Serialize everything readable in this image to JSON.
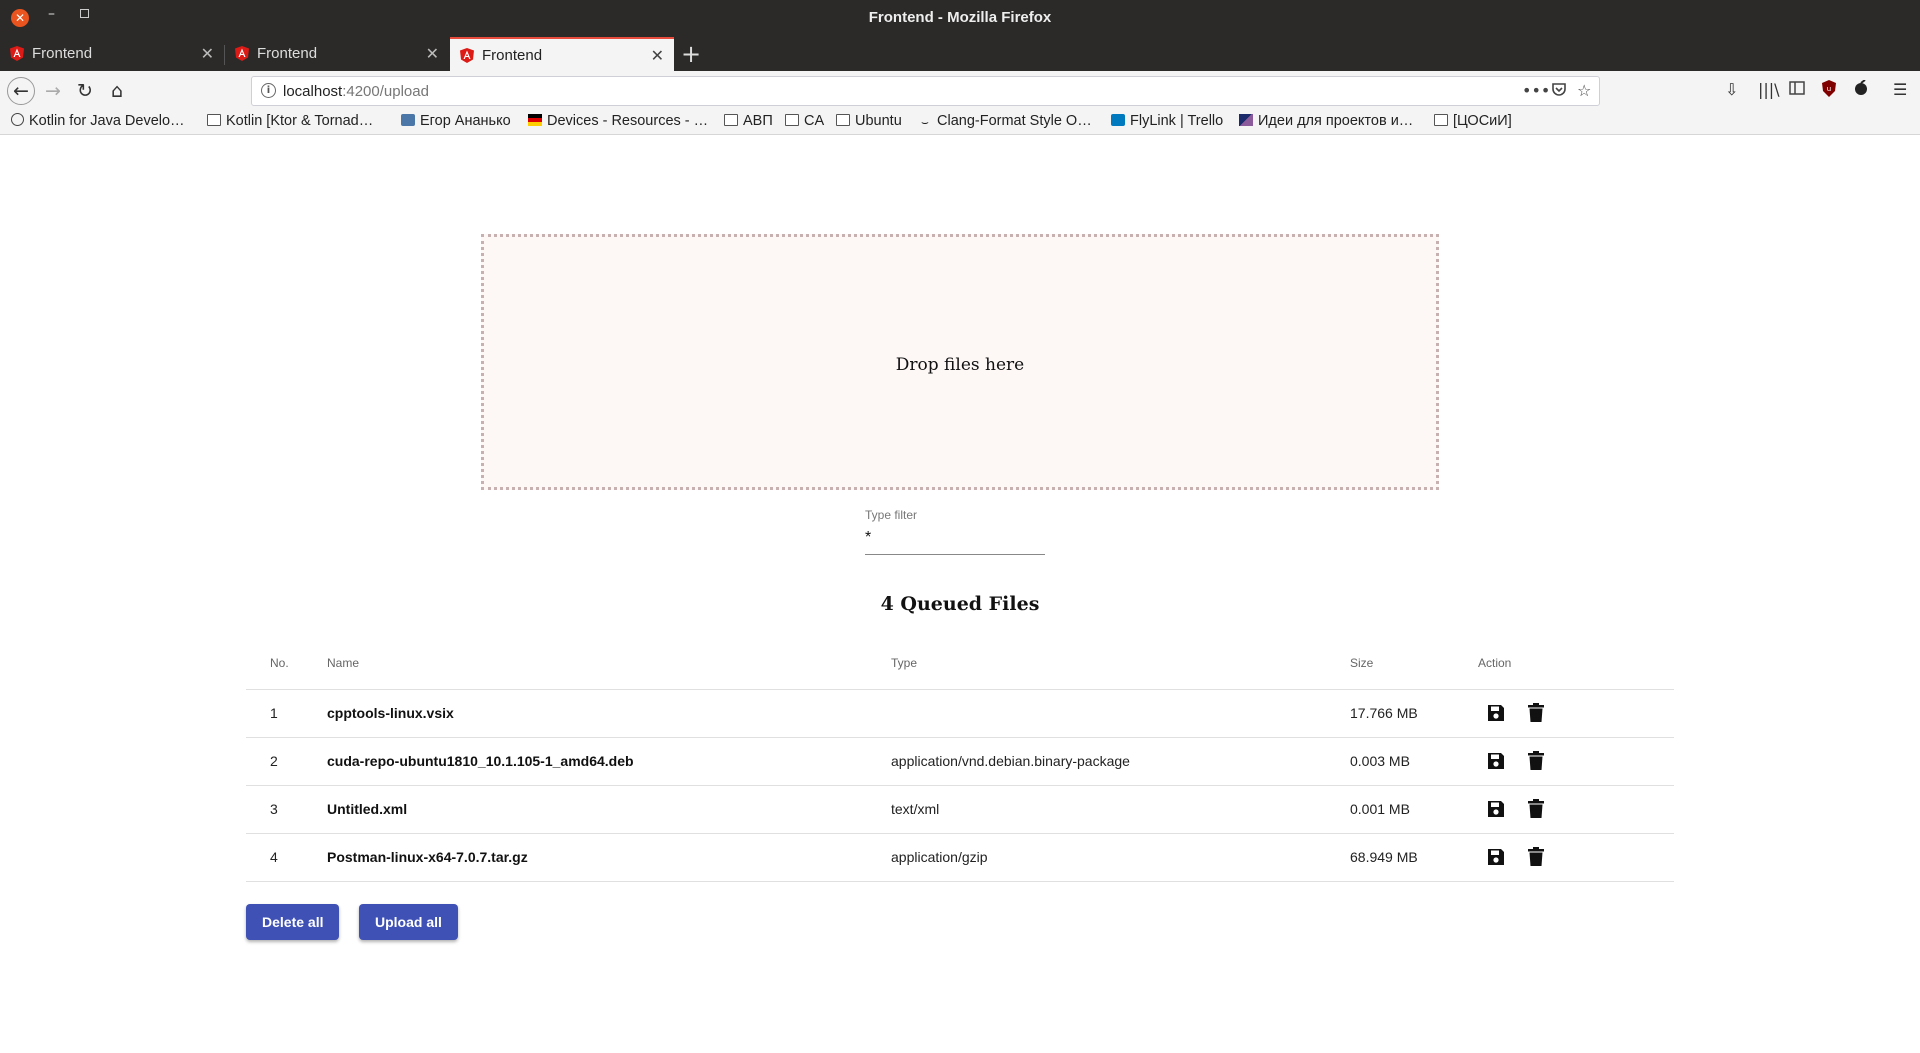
{
  "window": {
    "title": "Frontend - Mozilla Firefox"
  },
  "tabs": [
    {
      "label": "Frontend"
    },
    {
      "label": "Frontend"
    },
    {
      "label": "Frontend"
    }
  ],
  "url": {
    "host": "localhost",
    "path": ":4200/upload"
  },
  "bookmarks": [
    {
      "label": "Kotlin for Java Develo…",
      "icon": "globe-icon"
    },
    {
      "label": "Kotlin [Ktor & Tornad…",
      "icon": "folder-icon"
    },
    {
      "label": "Егор Ананько",
      "icon": "vk-icon"
    },
    {
      "label": "Devices - Resources - …",
      "icon": "flag-icon"
    },
    {
      "label": "АВП",
      "icon": "folder-icon"
    },
    {
      "label": "CA",
      "icon": "folder-icon"
    },
    {
      "label": "Ubuntu",
      "icon": "folder-icon"
    },
    {
      "label": "Clang-Format Style O…",
      "icon": "llvm-icon"
    },
    {
      "label": "FlyLink | Trello",
      "icon": "trello-icon"
    },
    {
      "label": "Идеи для проектов и…",
      "icon": "image-icon"
    },
    {
      "label": "[ЦОСиИ]",
      "icon": "folder-icon"
    }
  ],
  "dropzone": {
    "text": "Drop files here"
  },
  "filter": {
    "label": "Type filter",
    "value": "*"
  },
  "queue": {
    "title": "4 Queued Files",
    "headers": {
      "no": "No.",
      "name": "Name",
      "type": "Type",
      "size": "Size",
      "action": "Action"
    },
    "rows": [
      {
        "no": "1",
        "name": "cpptools-linux.vsix",
        "type": "",
        "size": "17.766 MB"
      },
      {
        "no": "2",
        "name": "cuda-repo-ubuntu1810_10.1.105-1_amd64.deb",
        "type": "application/vnd.debian.binary-package",
        "size": "0.003 MB"
      },
      {
        "no": "3",
        "name": "Untitled.xml",
        "type": "text/xml",
        "size": "0.001 MB"
      },
      {
        "no": "4",
        "name": "Postman-linux-x64-7.0.7.tar.gz",
        "type": "application/gzip",
        "size": "68.949 MB"
      }
    ]
  },
  "buttons": {
    "delete_all": "Delete all",
    "upload_all": "Upload all"
  },
  "colors": {
    "accent": "#3f51b5",
    "tab_highlight": "#e74c3c",
    "dropzone_border": "#c7b0b0"
  }
}
